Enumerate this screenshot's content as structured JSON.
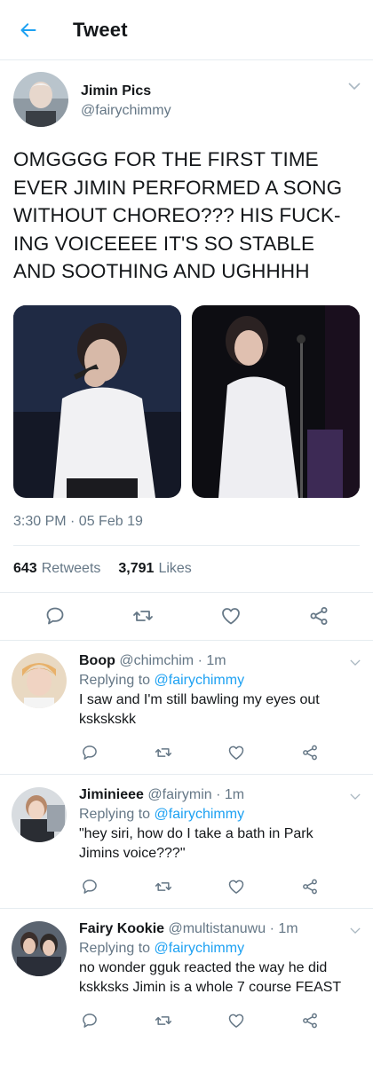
{
  "header": {
    "title": "Tweet"
  },
  "tweet": {
    "author_name": "Jimin Pics",
    "author_handle": "@fairychimmy",
    "text": "OMGGGG FOR THE FIRST TIME EVER JIMIN PERFORMED A SONG WITHOUT CHOREO??? HIS FUCK-ING VOICEEEE IT'S SO STABLE AND SOOTHING AND UGHHHH",
    "timestamp": "3:30 PM · 05 Feb 19",
    "retweets_count": "643",
    "retweets_label": "Retweets",
    "likes_count": "3,791",
    "likes_label": "Likes"
  },
  "replies": [
    {
      "name": "Boop",
      "handle": "@chimchim",
      "time": "· 1m",
      "replying_label": "Replying to",
      "replying_to": "@fairychimmy",
      "text": "I saw and I'm still bawling my eyes out kskskskk"
    },
    {
      "name": "Jiminieee",
      "handle": "@fairymin",
      "time": "· 1m",
      "replying_label": "Replying to",
      "replying_to": "@fairychimmy",
      "text": "\"hey siri, how do I take a bath in Park Jimins voice???\""
    },
    {
      "name": "Fairy Kookie",
      "handle": "@multistanuwu",
      "time": "· 1m",
      "replying_label": "Replying to",
      "replying_to": "@fairychimmy",
      "text": "no wonder gguk reacted the way he did kskksks Jimin is a whole 7 course FEAST"
    }
  ],
  "colors": {
    "accent": "#1da1f2",
    "secondary_text": "#657786",
    "divider": "#e6ecf0",
    "icon": "#657786"
  },
  "icons": [
    "back-arrow-icon",
    "chevron-down-icon",
    "reply-icon",
    "retweet-icon",
    "like-icon",
    "share-icon"
  ]
}
